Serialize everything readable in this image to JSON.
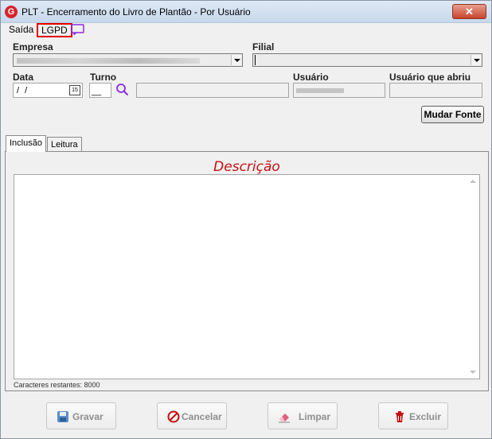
{
  "window": {
    "title": "PLT - Encerramento do Livro de Plantão - Por Usuário",
    "close_label": "✕",
    "icon_letter": "G"
  },
  "menu": {
    "saida": "Saída",
    "lgpd": "LGPD"
  },
  "form": {
    "empresa_label": "Empresa",
    "filial_label": "Filial",
    "data_label": "Data",
    "data_value": "/ /",
    "calendar_day": "15",
    "turno_label": "Turno",
    "turno_value": "__",
    "usuario_label": "Usuário",
    "usuario_abriu_label": "Usuário que abriu",
    "mudar_fonte_label": "Mudar Fonte"
  },
  "tabs": [
    {
      "label": "Inclusão"
    },
    {
      "label": "Leitura"
    }
  ],
  "panel": {
    "title": "Descrição",
    "chars_remaining": "Caracteres restantes: 8000"
  },
  "buttons": {
    "gravar": "Gravar",
    "cancelar": "Cancelar",
    "limpar": "Limpar",
    "excluir": "Excluir"
  },
  "colors": {
    "accent_red": "#c41010",
    "lgpd_highlight": "#e00000",
    "label_red": "#9c0000"
  }
}
